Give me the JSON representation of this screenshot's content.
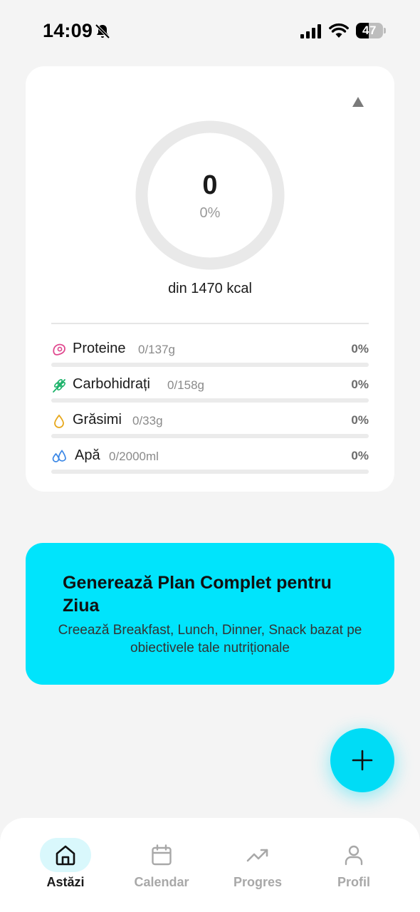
{
  "status_bar": {
    "time": "14:09",
    "battery_level": "47",
    "battery_fraction": 0.47,
    "icons": [
      "bell-slash-icon",
      "cellular-signal-icon",
      "wifi-icon",
      "battery-icon"
    ]
  },
  "summary": {
    "calories_value": "0",
    "calories_percent": "0%",
    "calories_target": "din 1470 kcal",
    "progress_fraction": 0,
    "ring_color": "#e9e9e9",
    "collapse_icon": "triangle-up-icon",
    "macros": [
      {
        "name": "Proteine",
        "amount": "0/137g",
        "percent": "0%",
        "fraction": 0,
        "icon": "meat-icon",
        "color": "#e0478e"
      },
      {
        "name": "Carbohidrați",
        "amount": "0/158g",
        "percent": "0%",
        "fraction": 0,
        "icon": "wheat-icon",
        "color": "#1eb36b"
      },
      {
        "name": "Grăsimi",
        "amount": "0/33g",
        "percent": "0%",
        "fraction": 0,
        "icon": "drop-icon",
        "color": "#e7a81d"
      },
      {
        "name": "Apă",
        "amount": "0/2000ml",
        "percent": "0%",
        "fraction": 0,
        "icon": "water-drops-icon",
        "color": "#3a87e6"
      }
    ]
  },
  "plan_card": {
    "title": "Generează Plan Complet pentru Ziua",
    "subtitle": "Creează Breakfast, Lunch, Dinner, Snack bazat pe obiectivele tale nutriționale",
    "background": "#00e4fc"
  },
  "fab": {
    "icon": "plus-icon",
    "color": "#00dcf6"
  },
  "nav": {
    "items": [
      {
        "label": "Astăzi",
        "icon": "home-icon",
        "active": true
      },
      {
        "label": "Calendar",
        "icon": "calendar-icon",
        "active": false
      },
      {
        "label": "Progres",
        "icon": "trending-up-icon",
        "active": false
      },
      {
        "label": "Profil",
        "icon": "user-icon",
        "active": false
      }
    ]
  }
}
